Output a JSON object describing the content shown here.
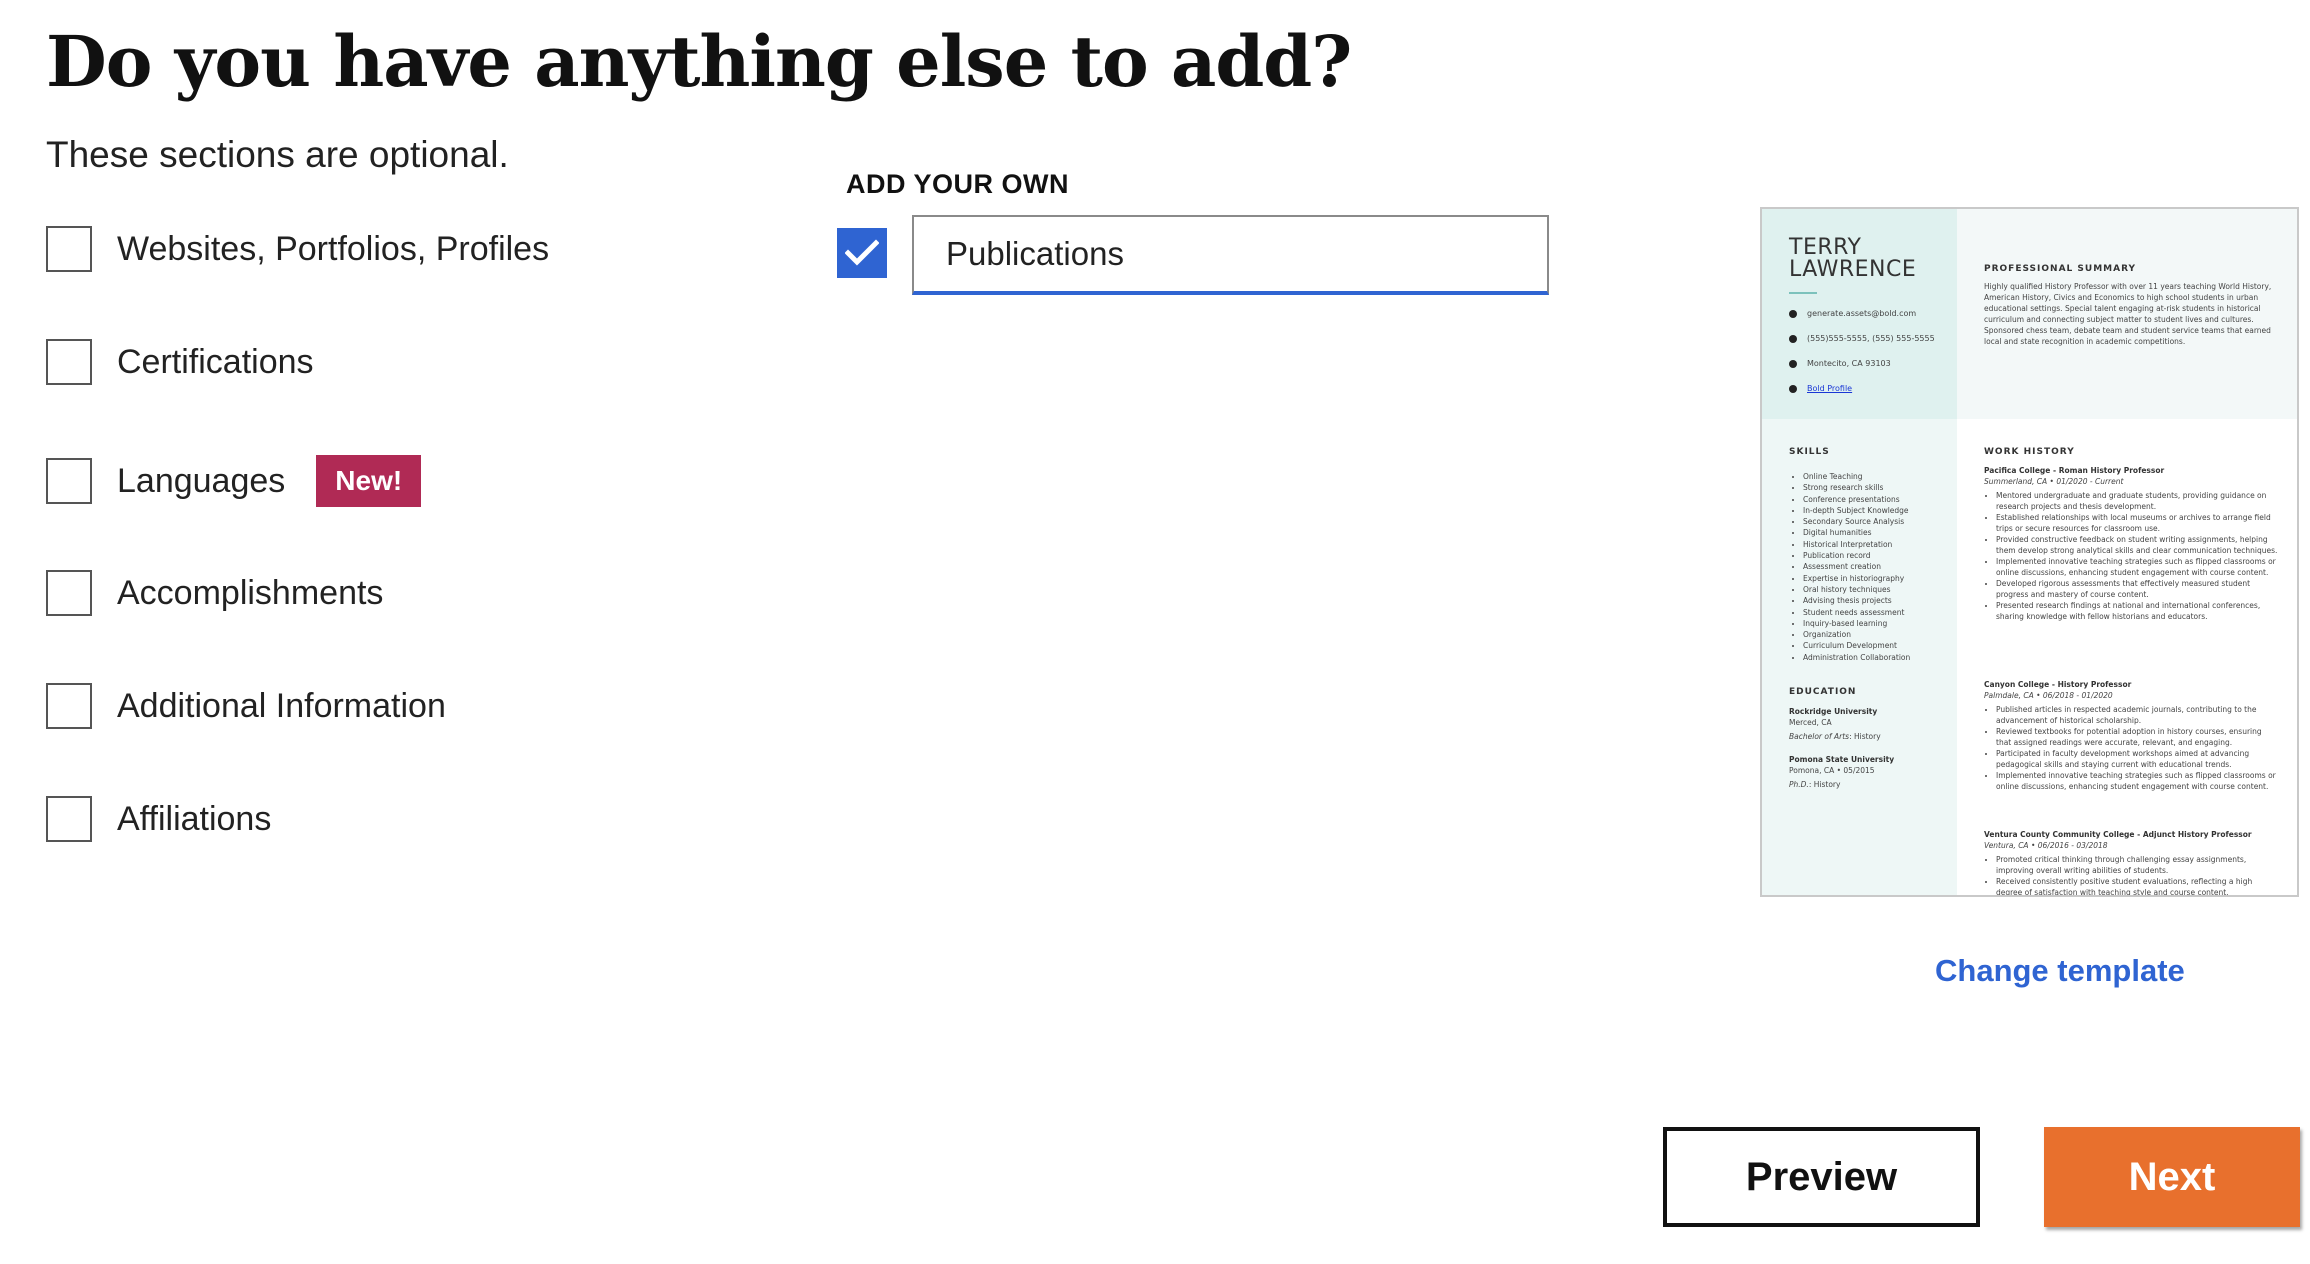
{
  "page": {
    "title": "Do you have anything else to add?",
    "subtitle": "These sections are optional."
  },
  "options": [
    {
      "label": "Websites, Portfolios, Profiles",
      "checked": false
    },
    {
      "label": "Certifications",
      "checked": false
    },
    {
      "label": "Languages",
      "checked": false,
      "badge": "New!"
    },
    {
      "label": "Accomplishments",
      "checked": false
    },
    {
      "label": "Additional Information",
      "checked": false
    },
    {
      "label": "Affiliations",
      "checked": false
    }
  ],
  "add_your_own": {
    "heading": "ADD YOUR OWN",
    "checked": true,
    "value": "Publications"
  },
  "resume": {
    "name_line1": "TERRY",
    "name_line2": "LAWRENCE",
    "contact": {
      "email": "generate.assets@bold.com",
      "phone": "(555)555-5555, (555) 555-5555",
      "location": "Montecito, CA 93103",
      "profile": "Bold Profile"
    },
    "summary_heading": "PROFESSIONAL SUMMARY",
    "summary": "Highly qualified History Professor with over 11 years teaching World History, American History, Civics and Economics to high school students in urban educational settings. Special talent engaging at-risk students in historical curriculum and connecting subject matter to student lives and cultures. Sponsored chess team, debate team and student service teams that earned local and state recognition in academic competitions.",
    "skills_heading": "SKILLS",
    "skills": [
      "Online Teaching",
      "Strong research skills",
      "Conference presentations",
      "In-depth Subject Knowledge",
      "Secondary Source Analysis",
      "Digital humanities",
      "Historical Interpretation",
      "Publication record",
      "Assessment creation",
      "Expertise in historiography",
      "Oral history techniques",
      "Advising thesis projects",
      "Student needs assessment",
      "Inquiry-based learning",
      "Organization",
      "Curriculum Development",
      "Administration Collaboration"
    ],
    "education_heading": "EDUCATION",
    "education": [
      {
        "school": "Rockridge University",
        "location": "Merced, CA",
        "degree_label": "Bachelor of Arts",
        "degree_field": "History"
      },
      {
        "school": "Pomona State University",
        "location": "Pomona, CA • 05/2015",
        "degree_label": "Ph.D.",
        "degree_field": "History"
      }
    ],
    "work_heading": "WORK HISTORY",
    "jobs": [
      {
        "title": "Pacifica College - Roman History Professor",
        "meta": "Summerland, CA • 01/2020 - Current",
        "bullets": [
          "Mentored undergraduate and graduate students, providing guidance on research projects and thesis development.",
          "Established relationships with local museums or archives to arrange field trips or secure resources for classroom use.",
          "Provided constructive feedback on student writing assignments, helping them develop strong analytical skills and clear communication techniques.",
          "Implemented innovative teaching strategies such as flipped classrooms or online discussions, enhancing student engagement with course content.",
          "Developed rigorous assessments that effectively measured student progress and mastery of course content.",
          "Presented research findings at national and international conferences, sharing knowledge with fellow historians and educators."
        ]
      },
      {
        "title": "Canyon College - History Professor",
        "meta": "Palmdale, CA • 06/2018 - 01/2020",
        "bullets": [
          "Published articles in respected academic journals, contributing to the advancement of historical scholarship.",
          "Reviewed textbooks for potential adoption in history courses, ensuring that assigned readings were accurate, relevant, and engaging.",
          "Participated in faculty development workshops aimed at advancing pedagogical skills and staying current with educational trends.",
          "Implemented innovative teaching strategies such as flipped classrooms or online discussions, enhancing student engagement with course content."
        ]
      },
      {
        "title": "Ventura County Community College - Adjunct History Professor",
        "meta": "Ventura, CA • 06/2016 - 03/2018",
        "bullets": [
          "Promoted critical thinking through challenging essay assignments, improving overall writing abilities of students.",
          "Received consistently positive student evaluations, reflecting a high degree of satisfaction with teaching style and course content."
        ]
      }
    ]
  },
  "change_template_label": "Change template",
  "buttons": {
    "preview": "Preview",
    "next": "Next"
  },
  "colors": {
    "accent_blue": "#2f64d2",
    "badge": "#b02a55",
    "next_button": "#e8702d",
    "resume_sidebar": "#dff1ef"
  }
}
